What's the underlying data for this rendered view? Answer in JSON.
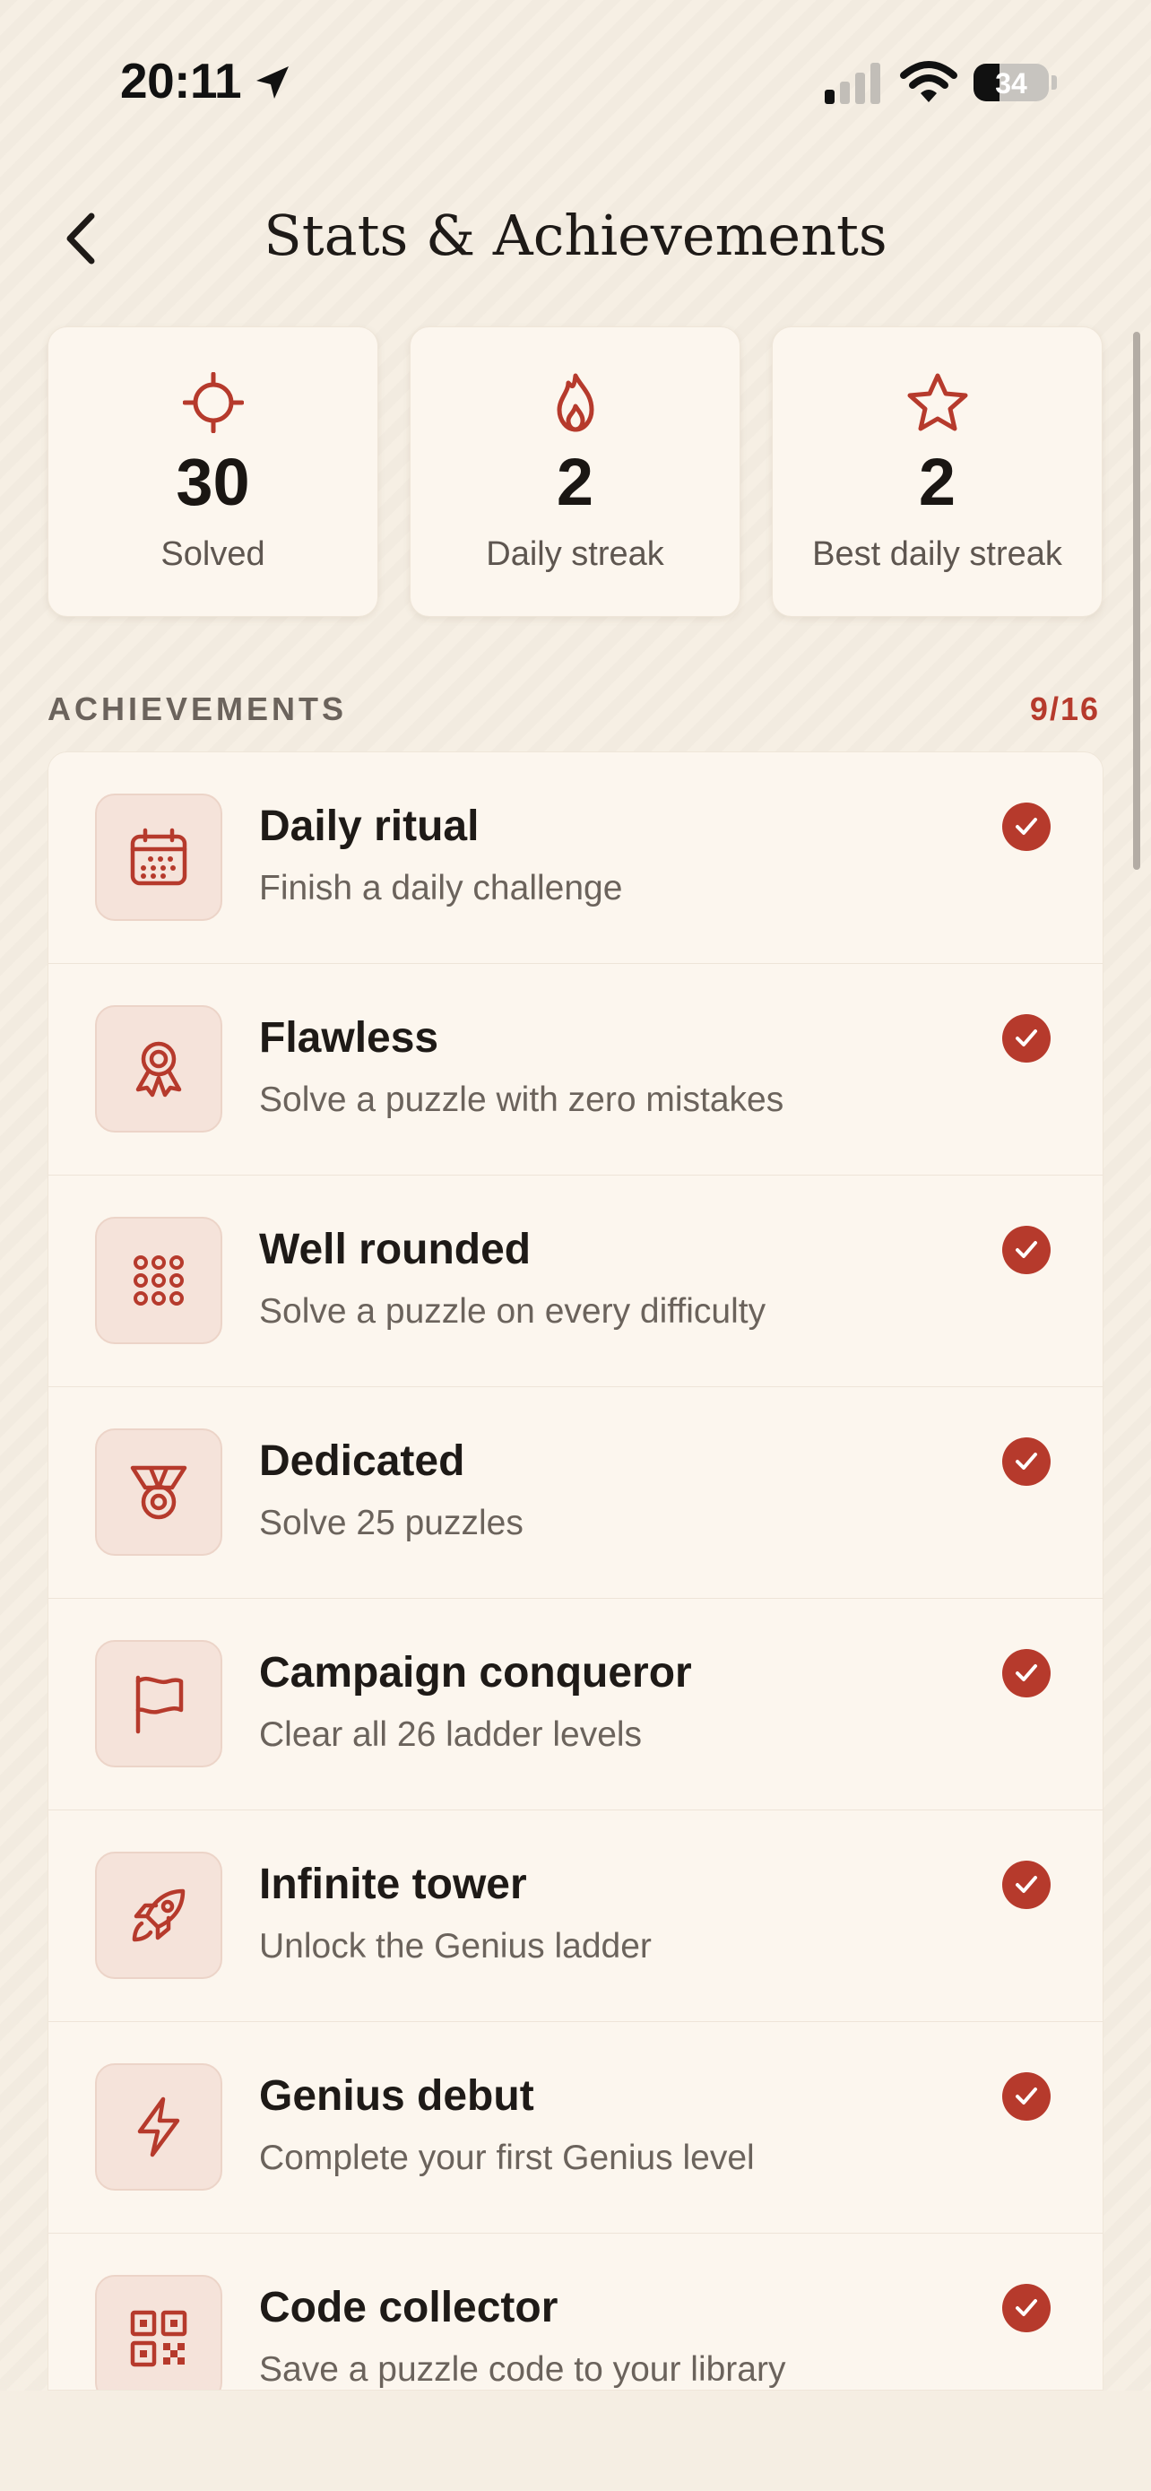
{
  "status_bar": {
    "time": "20:11",
    "battery_level": 34,
    "battery_text": "34"
  },
  "header": {
    "title": "Stats & Achievements"
  },
  "stats": [
    {
      "value": "30",
      "label": "Solved",
      "icon": "target-icon"
    },
    {
      "value": "2",
      "label": "Daily streak",
      "icon": "flame-icon"
    },
    {
      "value": "2",
      "label": "Best daily streak",
      "icon": "star-icon"
    }
  ],
  "achievements_section": {
    "label": "ACHIEVEMENTS",
    "count": "9/16"
  },
  "achievements": [
    {
      "title": "Daily ritual",
      "description": "Finish a daily challenge",
      "icon": "calendar-icon",
      "completed": true
    },
    {
      "title": "Flawless",
      "description": "Solve a puzzle with zero mistakes",
      "icon": "award-ribbon-icon",
      "completed": true
    },
    {
      "title": "Well rounded",
      "description": "Solve a puzzle on every difficulty",
      "icon": "dot-grid-icon",
      "completed": true
    },
    {
      "title": "Dedicated",
      "description": "Solve 25 puzzles",
      "icon": "medal-icon",
      "completed": true
    },
    {
      "title": "Campaign conqueror",
      "description": "Clear all 26 ladder levels",
      "icon": "flag-icon",
      "completed": true
    },
    {
      "title": "Infinite tower",
      "description": "Unlock the Genius ladder",
      "icon": "rocket-icon",
      "completed": true
    },
    {
      "title": "Genius debut",
      "description": "Complete your first Genius level",
      "icon": "lightning-icon",
      "completed": true
    },
    {
      "title": "Code collector",
      "description": "Save a puzzle code to your library",
      "icon": "qr-code-icon",
      "completed": true
    }
  ],
  "colors": {
    "accent": "#b63a2c",
    "background": "#f5eee3",
    "card": "#fcf6ee",
    "icon_tile": "#f5e3da"
  }
}
